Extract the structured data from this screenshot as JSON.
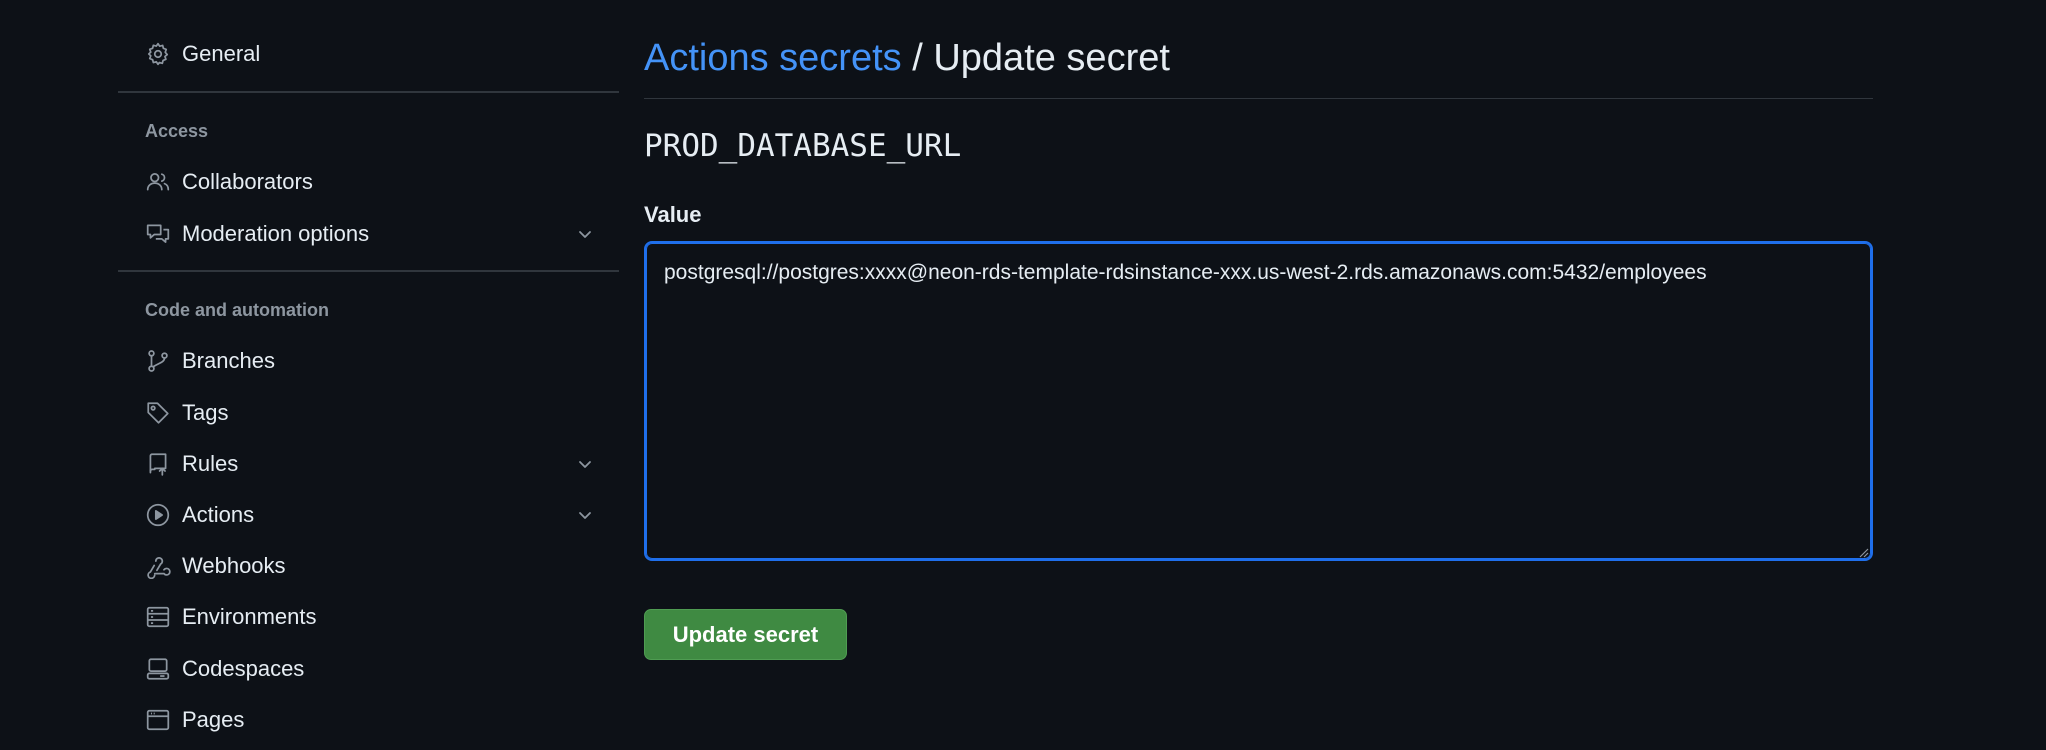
{
  "sidebar": {
    "general": {
      "label": "General",
      "icon": "gear-icon"
    },
    "access_heading": "Access",
    "access_items": [
      {
        "label": "Collaborators",
        "icon": "people-icon"
      },
      {
        "label": "Moderation options",
        "icon": "comment-discussion-icon",
        "expandable": true
      }
    ],
    "code_heading": "Code and automation",
    "code_items": [
      {
        "label": "Branches",
        "icon": "git-branch-icon"
      },
      {
        "label": "Tags",
        "icon": "tag-icon"
      },
      {
        "label": "Rules",
        "icon": "repo-push-icon",
        "expandable": true
      },
      {
        "label": "Actions",
        "icon": "play-icon",
        "expandable": true
      },
      {
        "label": "Webhooks",
        "icon": "webhook-icon"
      },
      {
        "label": "Environments",
        "icon": "server-icon"
      },
      {
        "label": "Codespaces",
        "icon": "codespaces-icon"
      },
      {
        "label": "Pages",
        "icon": "browser-icon"
      }
    ]
  },
  "main": {
    "breadcrumb_link": "Actions secrets",
    "breadcrumb_separator": " / ",
    "page_title": "Update secret",
    "secret_name": "PROD_DATABASE_URL",
    "value_label": "Value",
    "value": "postgresql://postgres:xxxx@neon-rds-template-rdsinstance-xxx.us-west-2.rds.amazonaws.com:5432/employees",
    "submit_label": "Update secret"
  },
  "colors": {
    "background": "#0d1117",
    "link": "#4493f8",
    "focus_border": "#1f6feb",
    "button": "#3f8a42",
    "muted_text": "#8d96a0"
  }
}
